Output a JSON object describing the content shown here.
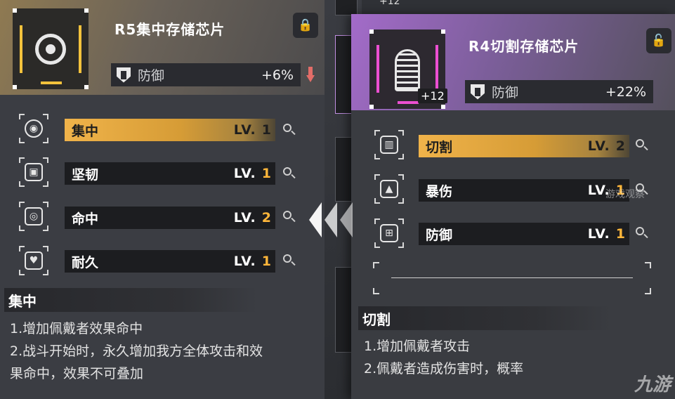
{
  "left_card": {
    "title": "R5集中存储芯片",
    "stat_name": "防御",
    "stat_value": "+6%",
    "skills": [
      {
        "name": "集中",
        "lv_label": "LV.",
        "lv": "1",
        "icon": "focus-eye-icon",
        "active": true
      },
      {
        "name": "坚韧",
        "lv_label": "LV.",
        "lv": "1",
        "icon": "robot-armor-icon",
        "active": false
      },
      {
        "name": "命中",
        "lv_label": "LV.",
        "lv": "2",
        "icon": "target-icon",
        "active": false
      },
      {
        "name": "耐久",
        "lv_label": "LV.",
        "lv": "1",
        "icon": "heart-plus-icon",
        "active": false
      }
    ],
    "desc_title": "集中",
    "desc_lines": [
      "1.增加佩戴者效果命中",
      "2.战斗开始时，永久增加我方全体攻击和效",
      "果命中，效果不可叠加"
    ]
  },
  "right_card": {
    "title": "R4切割存储芯片",
    "enhance": "+12",
    "stat_name": "防御",
    "stat_value": "+22%",
    "skills": [
      {
        "name": "切割",
        "lv_label": "LV.",
        "lv": "2",
        "icon": "saw-blade-icon",
        "active": true
      },
      {
        "name": "暴伤",
        "lv_label": "LV.",
        "lv": "1",
        "icon": "crit-damage-icon",
        "active": false
      },
      {
        "name": "防御",
        "lv_label": "LV.",
        "lv": "1",
        "icon": "defense-shield-icon",
        "active": false
      }
    ],
    "desc_title": "切割",
    "desc_lines": [
      "1.增加佩戴者攻击",
      "2.佩戴者造成伤害时，概率"
    ]
  },
  "background": {
    "enhance": "+12"
  },
  "watermarks": {
    "site": "游戏观察",
    "brand": "九游"
  },
  "colors": {
    "gold": "#f0b34a",
    "purple": "#a36bc9",
    "down_red": "#e36d68",
    "lock_bg": "#2a2b30"
  }
}
